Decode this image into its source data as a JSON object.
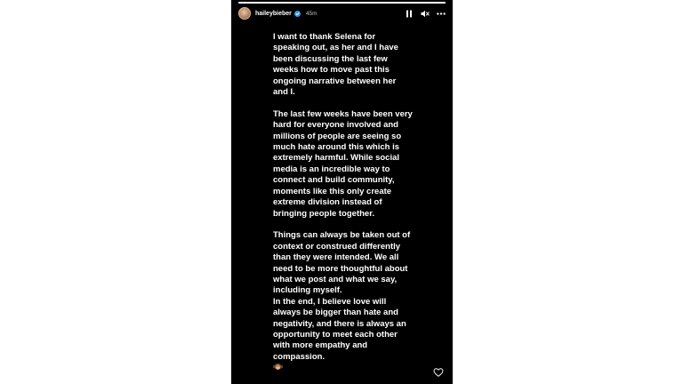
{
  "story": {
    "username": "haileybieber",
    "timestamp": "45m",
    "progress": 1.0,
    "verified_icon": "verified-badge-icon",
    "controls": [
      "pause-icon",
      "mute-icon",
      "more-options-icon"
    ],
    "like_icon": "heart-icon",
    "emoji_icon": "hear-no-evil-monkey-icon",
    "paragraph_1": "I want to thank Selena for\nspeaking out, as her and I have\nbeen discussing the last few\nweeks how to move past this\nongoing narrative between her\nand I.",
    "paragraph_2": "The last few weeks have been very\nhard for everyone involved and\nmillions of people are seeing so\nmuch hate around this which is\nextremely harmful. While social\nmedia is an incredible way to\nconnect and build community,\nmoments like this only create\nextreme division instead of\nbringing people together.",
    "paragraph_3": "Things can always be taken out of\ncontext or construed differently\nthan they were intended. We all\nneed to be more thoughtful about\nwhat we post and what we say,\nincluding myself.\nIn the end, I believe love will\nalways be bigger than hate and\nnegativity, and there is always an\nopportunity to meet each other\nwith more empathy and\ncompassion."
  },
  "colors": {
    "background": "#000000",
    "text": "#ffffff",
    "page": "#ffffff"
  }
}
